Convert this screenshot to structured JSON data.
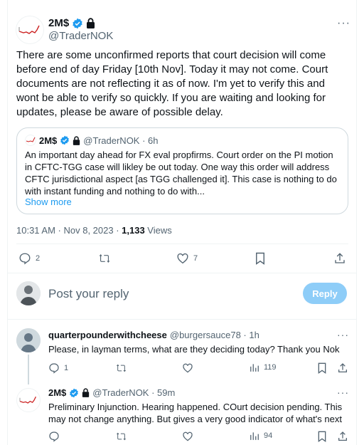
{
  "main_tweet": {
    "author_name": "2M$",
    "author_handle": "@TraderNOK",
    "text": "There are some unconfirmed reports that court decision will come before end of day Friday [10th Nov]. Today it may not come. Court documents are not reflecting it as of now. I'm yet to verify this and wont be able to verify so quickly. If you are waiting and looking for updates, please be aware of possible delay.",
    "time": "10:31 AM · Nov 8, 2023 · ",
    "views_count": "1,133",
    "views_label": " Views",
    "replies": "2",
    "retweets": "",
    "likes": "7"
  },
  "quoted_tweet": {
    "author_name": "2M$",
    "handle_time": "@TraderNOK · 6h",
    "text": "An important day ahead for FX eval propfirms. Court order on the PI motion in CFTC-TGG case will likley be out today. One way this order will address CFTC jurisdictional aspect [as TGG challenged it]. This case is nothing to do with instant funding and nothing to do with...",
    "show_more": "Show more"
  },
  "reply_box": {
    "placeholder": "Post your reply",
    "button": "Reply"
  },
  "replies": [
    {
      "author_name": "quarterpounderwithcheese",
      "handle_time": "@burgersauce78 · 1h",
      "text": "Please, in layman terms, what are they deciding today? Thank you Nok",
      "reply_count": "1",
      "views": "119"
    },
    {
      "author_name": "2M$",
      "handle_time": "@TraderNOK · 59m",
      "text": "Preliminary Injunction. Hearing happened. COurt decision pending. This may not change anything. But gives a very good indicator of what's next",
      "reply_count": "",
      "views": "94"
    }
  ],
  "colors": {
    "accent": "#1d9bf0",
    "reply_button_disabled": "#8ecdf8",
    "secondary_text": "#536471",
    "border": "#eff3f4"
  }
}
